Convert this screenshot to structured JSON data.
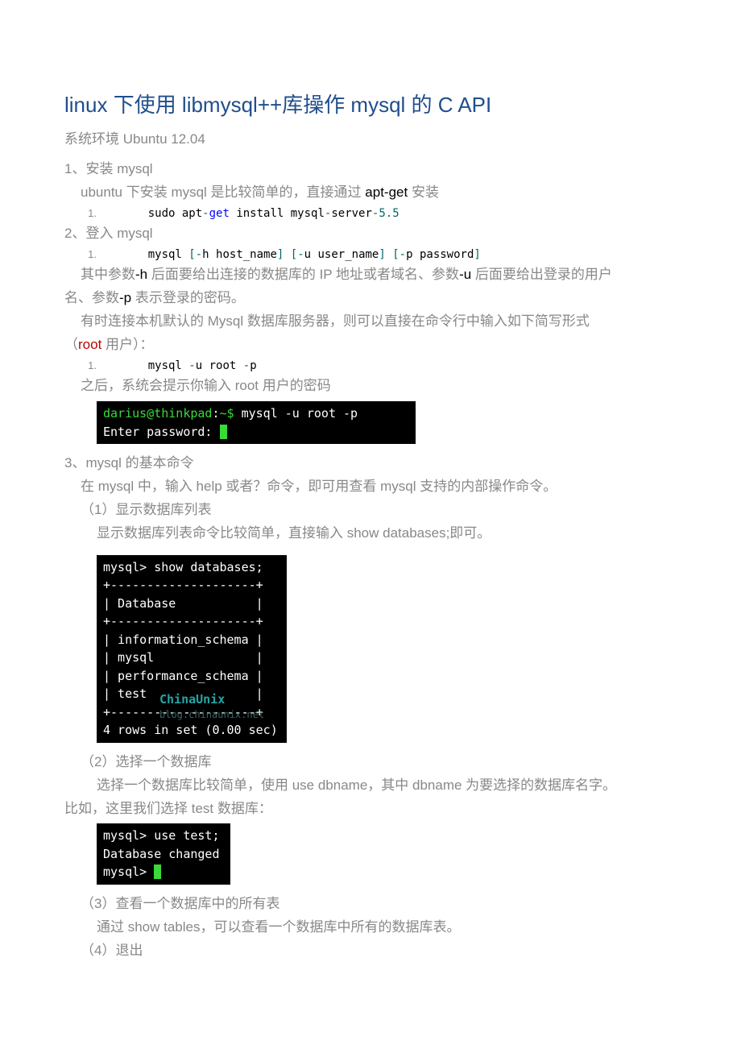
{
  "title": "linux 下使用 libmysql++库操作 mysql 的 C API",
  "env": "系统环境 Ubuntu 12.04",
  "s1": {
    "num": "1、",
    "heading": "安装 mysql",
    "line1_a": "ubuntu 下安装 mysql 是比较简单的，直接通过 ",
    "line1_b": "apt-get",
    "line1_c": " 安装",
    "code": {
      "num": "1.",
      "a": "    sudo apt",
      "b": "-",
      "c": "get",
      "d": " install mysql",
      "e": "-",
      "f": "server",
      "g": "-",
      "h": "5.5"
    }
  },
  "s2": {
    "num": "2、",
    "heading": "登入 mysql",
    "code1": {
      "num": "1.",
      "a": "    mysql ",
      "b": "[",
      "c": "-",
      "d": "h host_name",
      "e": "]",
      "f": " ",
      "g": "[",
      "h": "-",
      "i": "u user_name",
      "j": "]",
      "k": " ",
      "l": "[",
      "m": "-",
      "n": "p password",
      "o": "]"
    },
    "p1a": "其中参数",
    "p1b": "-h",
    "p1c": " 后面要给出连接的数据库的 IP 地址或者域名、参数",
    "p1d": "-u",
    "p1e": " 后面要给出登录的用户",
    "p2a": "名、参数",
    "p2b": "-p",
    "p2c": " 表示登录的密码。",
    "p3": "有时连接本机默认的 Mysql 数据库服务器，则可以直接在命令行中输入如下简写形式",
    "p4a": "（",
    "p4b": "root",
    "p4c": " 用户）：",
    "code2": {
      "num": "1.",
      "a": "    mysql ",
      "b": "-",
      "c": "u root ",
      "d": "-",
      "e": "p"
    },
    "p5": "之后，系统会提示你输入 root 用户的密码",
    "term1_l1a": "darius@thinkpad",
    "term1_l1b": ":",
    "term1_l1c": "~$",
    "term1_l1d": " mysql -u root -p",
    "term1_l2": "Enter password: ",
    "term1_cur": " "
  },
  "s3": {
    "num": "3、",
    "heading": "mysql 的基本命令",
    "p1": "在 mysql 中，输入 help 或者？命令，即可用查看 mysql 支持的内部操作命令。",
    "sub1_num": "（1）",
    "sub1_t": "显示数据库列表",
    "sub1_p": "显示数据库列表命令比较简单，直接输入 show databases;即可。",
    "term2": "mysql> show databases;\n+--------------------+\n| Database           |\n+--------------------+\n| information_schema |\n| mysql              |\n| performance_schema |\n| test               |\n+--------------------+\n4 rows in set (0.00 sec)",
    "term2_watermark": "ChinaUnix",
    "term2_watermark2": "blog.chinaunix.net",
    "sub2_num": "（2）",
    "sub2_t": "选择一个数据库",
    "sub2_p1": "选择一个数据库比较简单，使用 use dbname，其中 dbname 为要选择的数据库名字。",
    "sub2_p2": "比如，这里我们选择 test 数据库：",
    "term3_l1": "mysql> use test;",
    "term3_l2": "Database changed",
    "term3_l3": "mysql> ",
    "term3_cur": " ",
    "sub3_num": "（3）",
    "sub3_t": "查看一个数据库中的所有表",
    "sub3_p": "通过 show tables，可以查看一个数据库中所有的数据库表。",
    "sub4_num": "（4）",
    "sub4_t": "退出"
  }
}
